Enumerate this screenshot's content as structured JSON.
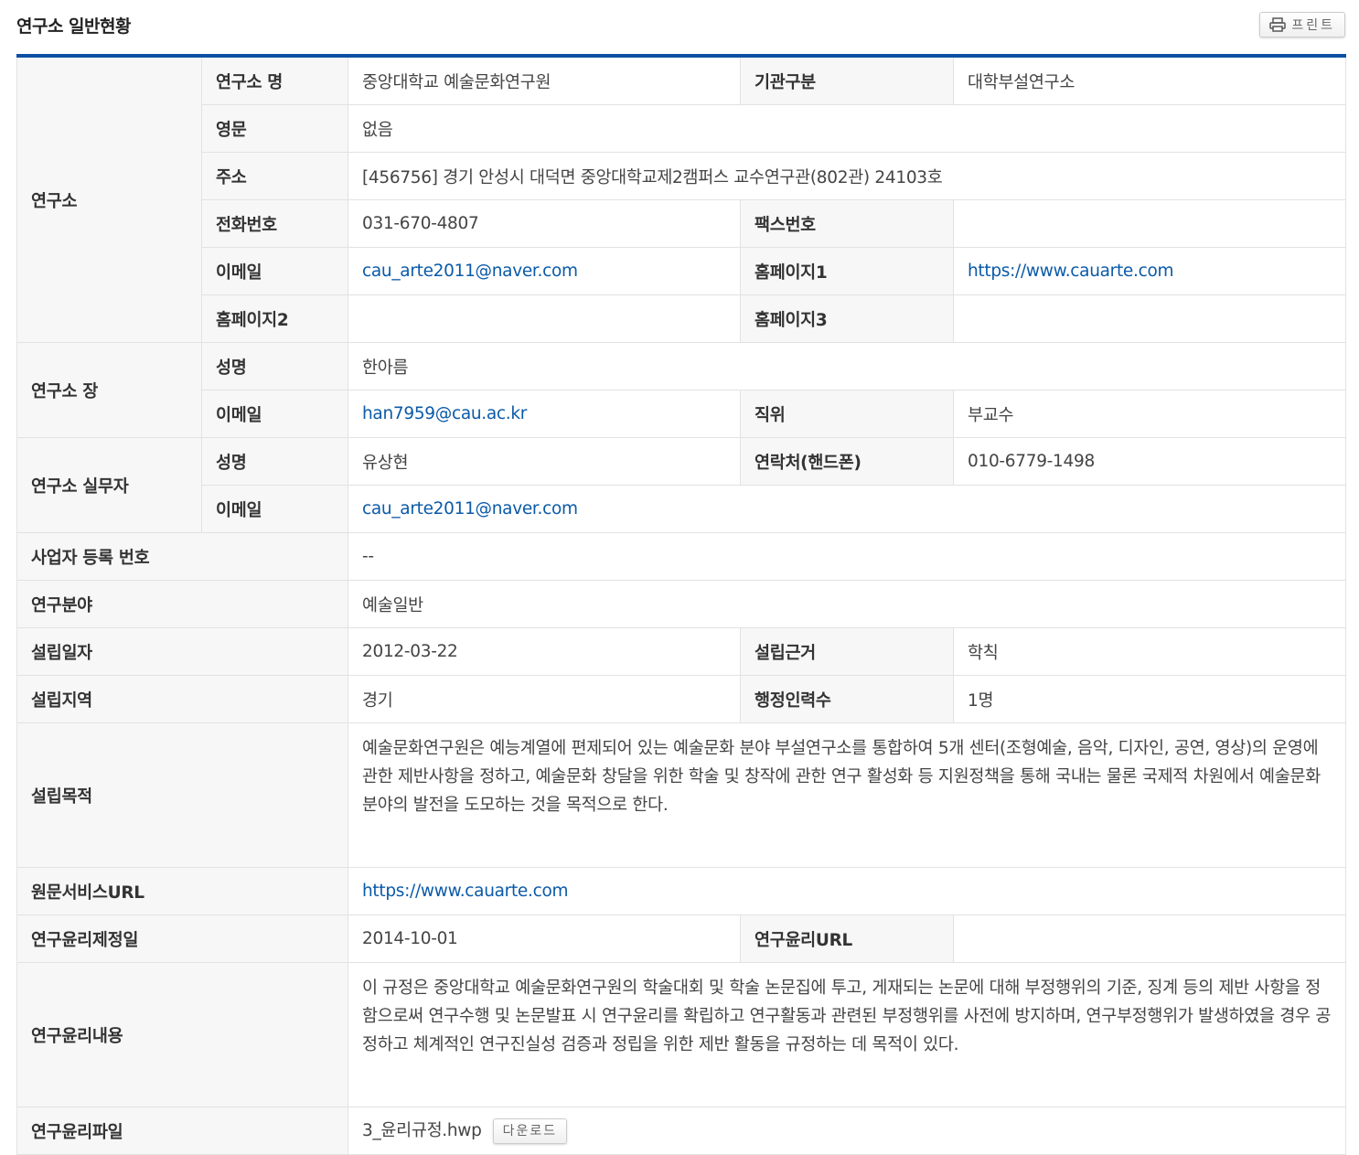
{
  "title": "연구소 일반현황",
  "print_label": "프린트",
  "rows": [
    {
      "cells": [
        {
          "t": "연구소",
          "l": 1,
          "rs": 6
        },
        {
          "t": "연구소 명",
          "l": 1
        },
        {
          "t": "중앙대학교 예술문화연구원"
        },
        {
          "t": "기관구분",
          "l": 1
        },
        {
          "t": "대학부설연구소"
        }
      ]
    },
    {
      "cells": [
        {
          "t": "영문",
          "l": 1
        },
        {
          "t": "없음",
          "cs": 3
        }
      ]
    },
    {
      "cells": [
        {
          "t": "주소",
          "l": 1
        },
        {
          "t": "[456756] 경기 안성시 대덕면 중앙대학교제2캠퍼스 교수연구관(802관) 24103호",
          "cs": 3
        }
      ]
    },
    {
      "cells": [
        {
          "t": "전화번호",
          "l": 1
        },
        {
          "t": "031-670-4807"
        },
        {
          "t": "팩스번호",
          "l": 1
        },
        {
          "t": ""
        }
      ]
    },
    {
      "cells": [
        {
          "t": "이메일",
          "l": 1
        },
        {
          "t": "cau_arte2011@naver.com",
          "link": 1
        },
        {
          "t": "홈페이지1",
          "l": 1
        },
        {
          "t": "https://www.cauarte.com",
          "link": 1
        }
      ]
    },
    {
      "cells": [
        {
          "t": "홈페이지2",
          "l": 1
        },
        {
          "t": ""
        },
        {
          "t": "홈페이지3",
          "l": 1
        },
        {
          "t": ""
        }
      ]
    },
    {
      "cells": [
        {
          "t": "연구소 장",
          "l": 1,
          "rs": 2
        },
        {
          "t": "성명",
          "l": 1
        },
        {
          "t": "한아름",
          "cs": 3
        }
      ]
    },
    {
      "cells": [
        {
          "t": "이메일",
          "l": 1
        },
        {
          "t": "han7959@cau.ac.kr",
          "link": 1
        },
        {
          "t": "직위",
          "l": 1
        },
        {
          "t": "부교수"
        }
      ]
    },
    {
      "cells": [
        {
          "t": "연구소 실무자",
          "l": 1,
          "rs": 2
        },
        {
          "t": "성명",
          "l": 1
        },
        {
          "t": "유상현"
        },
        {
          "t": "연락처(핸드폰)",
          "l": 1
        },
        {
          "t": "010-6779-1498"
        }
      ]
    },
    {
      "cells": [
        {
          "t": "이메일",
          "l": 1
        },
        {
          "t": "cau_arte2011@naver.com",
          "link": 1,
          "cs": 3
        }
      ]
    },
    {
      "cells": [
        {
          "t": "사업자 등록 번호",
          "l": 1,
          "cs": 2
        },
        {
          "t": "--",
          "cs": 3
        }
      ]
    },
    {
      "cells": [
        {
          "t": "연구분야",
          "l": 1,
          "cs": 2
        },
        {
          "t": "예술일반",
          "cs": 3
        }
      ]
    },
    {
      "cells": [
        {
          "t": "설립일자",
          "l": 1,
          "cs": 2
        },
        {
          "t": "2012-03-22"
        },
        {
          "t": "설립근거",
          "l": 1
        },
        {
          "t": "학칙"
        }
      ]
    },
    {
      "cells": [
        {
          "t": "설립지역",
          "l": 1,
          "cs": 2
        },
        {
          "t": "경기"
        },
        {
          "t": "행정인력수",
          "l": 1
        },
        {
          "t": "1명"
        }
      ]
    },
    {
      "cells": [
        {
          "t": "설립목적",
          "l": 1,
          "cs": 2,
          "tall": 1
        },
        {
          "t": "예술문화연구원은 예능계열에 편제되어 있는 예술문화 분야 부설연구소를 통합하여 5개 센터(조형예술, 음악, 디자인, 공연, 영상)의 운영에 관한 제반사항을 정하고, 예술문화 창달을 위한 학술 및 창작에 관한 연구 활성화 등 지원정책을 통해 국내는 물론 국제적 차원에서 예술문화 분야의 발전을 도모하는 것을 목적으로 한다.",
          "cs": 3,
          "tall": 1
        }
      ]
    },
    {
      "cells": [
        {
          "t": "원문서비스URL",
          "l": 1,
          "cs": 2
        },
        {
          "t": "https://www.cauarte.com",
          "link": 1,
          "cs": 3
        }
      ]
    },
    {
      "cells": [
        {
          "t": "연구윤리제정일",
          "l": 1,
          "cs": 2
        },
        {
          "t": "2014-10-01"
        },
        {
          "t": "연구윤리URL",
          "l": 1
        },
        {
          "t": ""
        }
      ]
    },
    {
      "cells": [
        {
          "t": "연구윤리내용",
          "l": 1,
          "cs": 2,
          "tall": 1
        },
        {
          "t": "이 규정은 중앙대학교 예술문화연구원의 학술대회 및 학술 논문집에 투고, 게재되는 논문에 대해 부정행위의 기준, 징계 등의 제반 사항을 정함으로써 연구수행 및 논문발표 시 연구윤리를 확립하고 연구활동과 관련된 부정행위를 사전에 방지하며, 연구부정행위가 발생하였을 경우 공정하고 체계적인 연구진실성 검증과 정립을 위한 제반 활동을 규정하는 데 목적이 있다.",
          "cs": 3,
          "tall": 1
        }
      ]
    },
    {
      "cells": [
        {
          "t": "연구윤리파일",
          "l": 1,
          "cs": 2
        },
        {
          "t": "3_윤리규정.hwp",
          "cs": 3,
          "file": 1
        }
      ]
    }
  ],
  "download_label": "다운로드"
}
